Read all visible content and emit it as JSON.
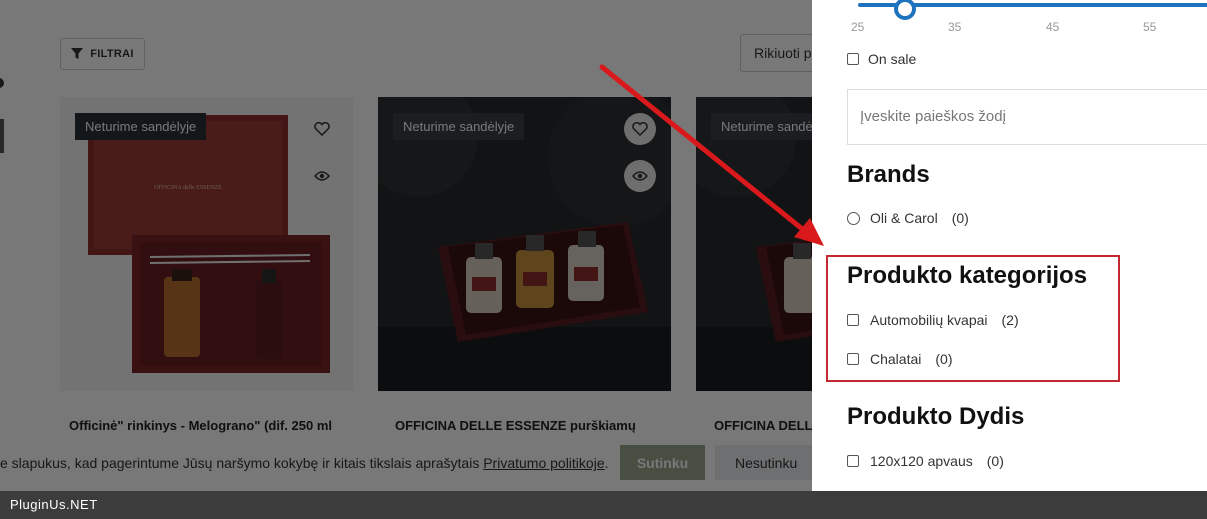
{
  "shop": {
    "filter_label": "FILTRAI",
    "sort_label": "Rikiuoti p",
    "products": [
      {
        "badge": "Neturime sandėlyje",
        "title": "Officinė\" rinkinys - Melograno\" (dif. 250 ml"
      },
      {
        "badge": "Neturime sandėlyje",
        "title": "OFFICINA DELLE ESSENZE purškiamų"
      },
      {
        "badge": "Neturime sandė",
        "title": "OFFICINA DELL"
      }
    ]
  },
  "cookie": {
    "text": "e slapukus, kad pagerintume Jūsų naršymo kokybę ir kitais tikslais aprašytais ",
    "link": "Privatumo politikoje",
    "suffix": ".",
    "accept": "Sutinku",
    "decline": "Nesutinku"
  },
  "panel": {
    "slider_ticks": [
      "25",
      "35",
      "45",
      "55"
    ],
    "on_sale_label": "On sale",
    "search_placeholder": "Įveskite paieškos žodį",
    "brands": {
      "heading": "Brands",
      "items": [
        {
          "label": "Oli & Carol",
          "count": "(0)"
        }
      ]
    },
    "categories": {
      "heading": "Produkto kategorijos",
      "items": [
        {
          "label": "Automobilių kvapai",
          "count": "(2)"
        },
        {
          "label": "Chalatai",
          "count": "(0)"
        }
      ]
    },
    "sizes": {
      "heading": "Produkto Dydis",
      "items": [
        {
          "label": "120x120 apvaus",
          "count": "(0)"
        }
      ]
    }
  },
  "footer": {
    "brand": "PluginUs.NET"
  },
  "colors": {
    "accent_blue": "#1e73be",
    "highlight_red": "#c4272f",
    "arrow_red": "#d9191c",
    "accept_green": "#9aa68c"
  }
}
